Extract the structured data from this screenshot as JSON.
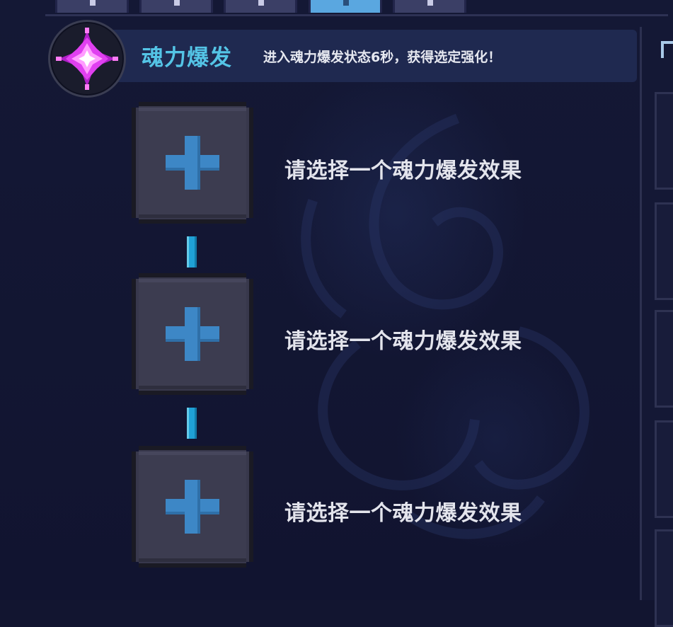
{
  "skill": {
    "icon": "soul-burst-crystal-icon",
    "title": "魂力爆发",
    "description": "进入魂力爆发状态6秒，获得选定强化！"
  },
  "tabs": [
    {
      "icon": "tab-icon-1",
      "active": false
    },
    {
      "icon": "tab-icon-2",
      "active": false
    },
    {
      "icon": "tab-icon-3",
      "active": false
    },
    {
      "icon": "tab-icon-4",
      "active": true
    },
    {
      "icon": "tab-icon-5",
      "active": false
    }
  ],
  "slots": [
    {
      "icon": "plus-icon",
      "label": "请选择一个魂力爆发效果"
    },
    {
      "icon": "plus-icon",
      "label": "请选择一个魂力爆发效果"
    },
    {
      "icon": "plus-icon",
      "label": "请选择一个魂力爆发效果"
    }
  ],
  "colors": {
    "accent": "#54c4e6",
    "plus": "#3d87c6",
    "connector": "#1fa1d6",
    "active_tab": "#5aa7e0",
    "icon_glow": "#e040f0"
  }
}
